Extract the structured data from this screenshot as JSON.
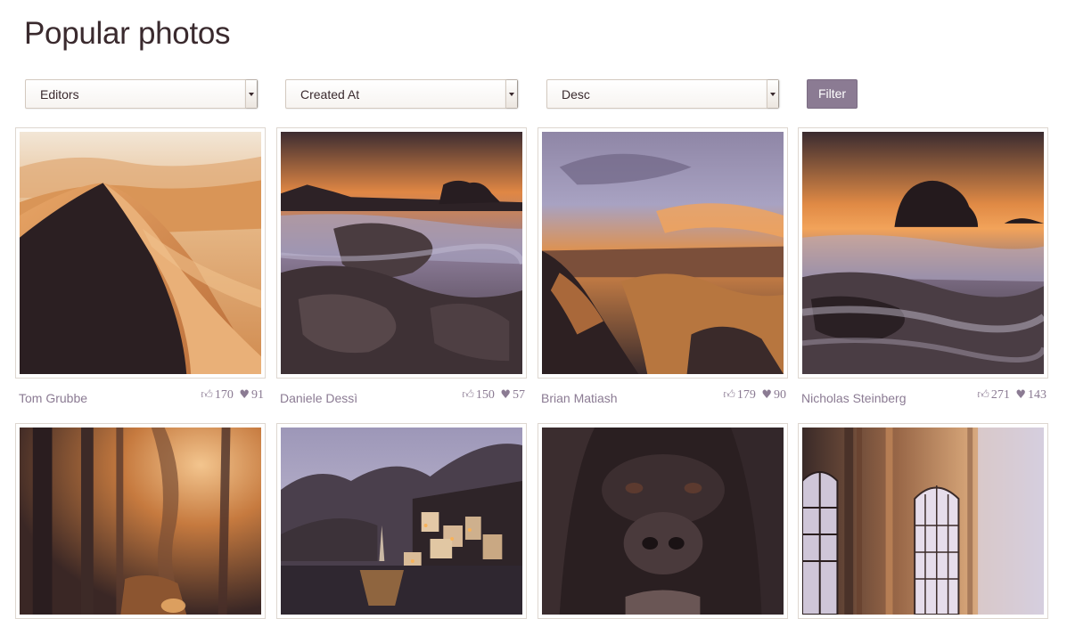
{
  "page": {
    "title": "Popular photos"
  },
  "filters": {
    "feature": {
      "value": "Editors"
    },
    "sort": {
      "value": "Created At"
    },
    "direction": {
      "value": "Desc"
    },
    "button_label": "Filter"
  },
  "icons": {
    "like": "thumbs-up-icon",
    "favorite": "heart-icon"
  },
  "colors": {
    "accent": "#8b7b93",
    "title": "#3a2a2e"
  },
  "photos": [
    {
      "author": "Tom Grubbe",
      "likes": "170",
      "favorites": "91",
      "subject": "desert-dunes"
    },
    {
      "author": "Daniele Dessì",
      "likes": "150",
      "favorites": "57",
      "subject": "rocky-seashore"
    },
    {
      "author": "Brian Matiash",
      "likes": "179",
      "favorites": "90",
      "subject": "canyon-sunset"
    },
    {
      "author": "Nicholas Steinberg",
      "likes": "271",
      "favorites": "143",
      "subject": "island-waves"
    },
    {
      "subject": "foggy-forest"
    },
    {
      "subject": "lakeside-village"
    },
    {
      "subject": "gorilla-face"
    },
    {
      "subject": "arched-windows"
    }
  ]
}
